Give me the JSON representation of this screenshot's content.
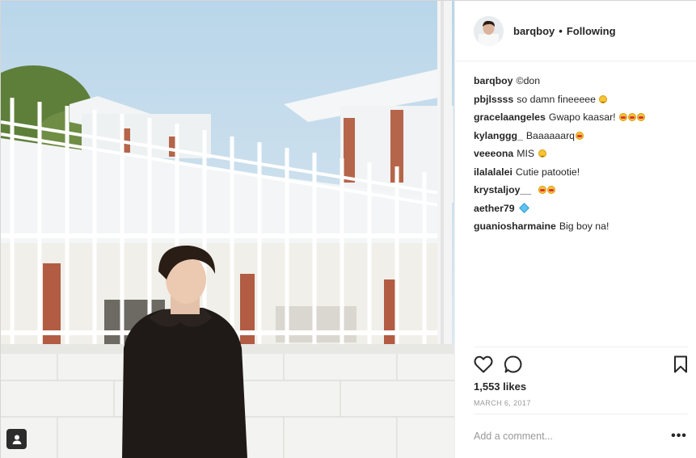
{
  "post": {
    "username": "barqboy",
    "separator": "•",
    "follow_status": "Following",
    "caption": {
      "user": "barqboy",
      "text": "©don"
    },
    "comments": [
      {
        "user": "pbjlssss",
        "text": "so damn fineeeee",
        "emoji": [
          "smile"
        ]
      },
      {
        "user": "gracelaangeles",
        "text": "Gwapo kaasar!",
        "emoji": [
          "heart",
          "heart",
          "heart"
        ]
      },
      {
        "user": "kylanggg_",
        "text": "Baaaaaarq",
        "emoji": [
          "heart"
        ]
      },
      {
        "user": "veeeona",
        "text": "MIS",
        "emoji": [
          "smile"
        ]
      },
      {
        "user": "ilalalalei",
        "text": "Cutie patootie!",
        "emoji": []
      },
      {
        "user": "krystaljoy__",
        "text": "",
        "emoji": [
          "heart",
          "heart"
        ]
      },
      {
        "user": "aether79",
        "text": "",
        "emoji": [
          "diamond"
        ]
      },
      {
        "user": "guaniosharmaine",
        "text": "Big boy na!",
        "emoji": []
      }
    ],
    "likes": "1,553 likes",
    "date": "MARCH 6, 2017",
    "add_comment_placeholder": "Add a comment...",
    "more_label": "•••"
  },
  "icons": {
    "like": "heart-outline-icon",
    "comment": "speech-bubble-icon",
    "save": "bookmark-icon",
    "user_tag": "person-tag-icon"
  }
}
